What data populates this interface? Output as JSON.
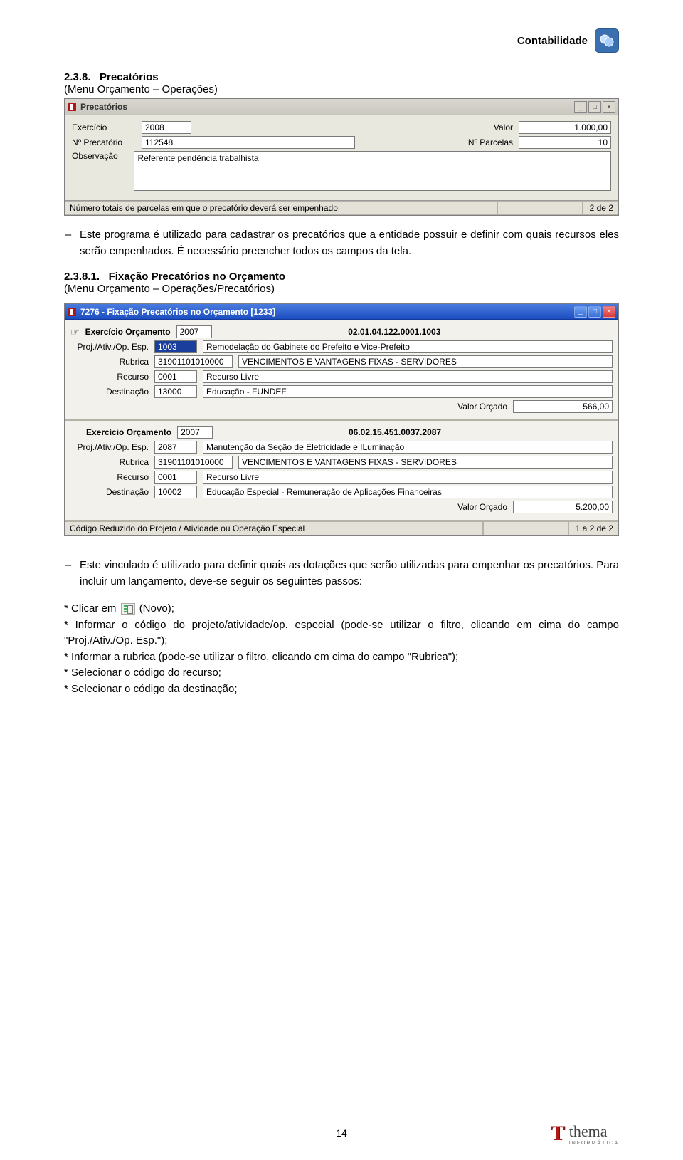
{
  "header": {
    "brand": "Contabilidade"
  },
  "section1": {
    "num": "2.3.8.",
    "title": "Precatórios",
    "menu": "(Menu Orçamento – Operações)"
  },
  "win1": {
    "title": "Precatórios",
    "labels": {
      "exercicio": "Exercício",
      "valor": "Valor",
      "numPrecatorio": "Nº Precatório",
      "numParcelas": "Nº Parcelas",
      "observacao": "Observação"
    },
    "values": {
      "exercicio": "2008",
      "valor": "1.000,00",
      "numPrecatorio": "112548",
      "numParcelas": "10",
      "observacao": "Referente pendência trabalhista"
    },
    "status": {
      "msg": "Número totais de parcelas em que o precatório deverá ser empenhado",
      "counter": "2 de 2"
    }
  },
  "para1": "Este programa é utilizado para cadastrar os precatórios que a entidade possuir e definir com quais recursos eles serão empenhados. É necessário preencher todos os campos da tela.",
  "section2": {
    "num": "2.3.8.1.",
    "title": "Fixação Precatórios no Orçamento",
    "menu": "(Menu Orçamento – Operações/Precatórios)"
  },
  "win2": {
    "title": "7276 - Fixação Precatórios no Orçamento [1233]",
    "labels": {
      "exercicioOrc": "Exercício Orçamento",
      "proj": "Proj./Ativ./Op. Esp.",
      "rubrica": "Rubrica",
      "recurso": "Recurso",
      "destinacao": "Destinação",
      "valorOrcado": "Valor Orçado"
    },
    "g1": {
      "exercicio": "2007",
      "code": "02.01.04.122.0001.1003",
      "proj": "1003",
      "projDesc": "Remodelação do Gabinete do Prefeito e Vice-Prefeito",
      "rubrica": "31901101010000",
      "rubricaDesc": "VENCIMENTOS E VANTAGENS FIXAS - SERVIDORES",
      "recurso": "0001",
      "recursoDesc": "Recurso Livre",
      "destinacao": "13000",
      "destinacaoDesc": "Educação - FUNDEF",
      "valor": "566,00"
    },
    "g2": {
      "exercicio": "2007",
      "code": "06.02.15.451.0037.2087",
      "proj": "2087",
      "projDesc": "Manutenção da Seção de Eletricidade e ILuminação",
      "rubrica": "31901101010000",
      "rubricaDesc": "VENCIMENTOS E VANTAGENS FIXAS - SERVIDORES",
      "recurso": "0001",
      "recursoDesc": "Recurso Livre",
      "destinacao": "10002",
      "destinacaoDesc": "Educação Especial - Remuneração de Aplicações Financeiras",
      "valor": "5.200,00"
    },
    "status": {
      "msg": "Código Reduzido do Projeto / Atividade ou Operação Especial",
      "counter": "1 a 2 de 2"
    }
  },
  "para2_a": "Este vinculado é utilizado para definir quais as dotações que serão utilizadas para empenhar os precatórios. Para incluir um lançamento, deve-se seguir os seguintes passos:",
  "steps": {
    "s1a": "* Clicar em ",
    "s1b": " (Novo);",
    "s2": "* Informar o código do projeto/atividade/op. especial (pode-se utilizar o filtro, clicando em cima do campo \"Proj./Ativ./Op. Esp.\");",
    "s3": "* Informar a rubrica (pode-se utilizar o filtro, clicando em cima do campo \"Rubrica\");",
    "s4": "* Selecionar o código do recurso;",
    "s5": "* Selecionar o código da destinação;"
  },
  "footer": {
    "page": "14",
    "brand": "thema",
    "brandSub": "INFORMÁTICA"
  }
}
